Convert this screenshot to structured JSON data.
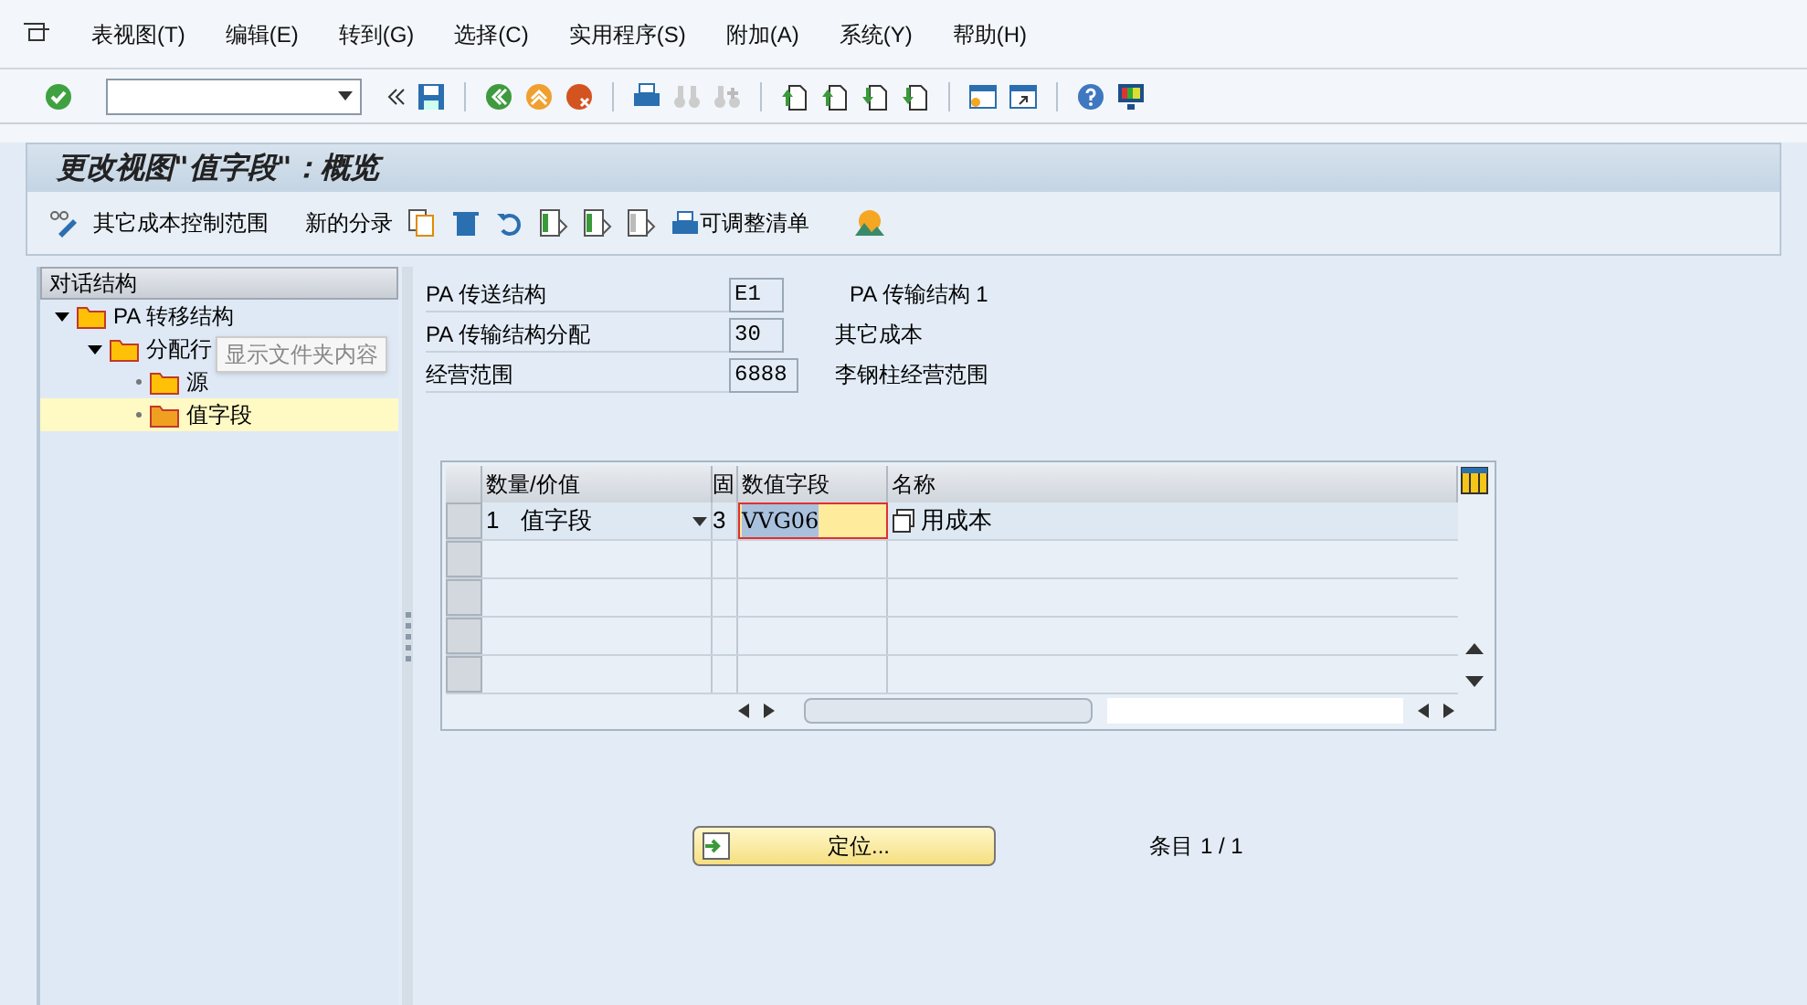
{
  "menu": [
    "表视图(T)",
    "编辑(E)",
    "转到(G)",
    "选择(C)",
    "实用程序(S)",
    "附加(A)",
    "系统(Y)",
    "帮助(H)"
  ],
  "title": "更改视图\"值字段\"：概览",
  "app_toolbar": [
    {
      "kind": "icon-text",
      "label": "其它成本控制范围"
    },
    {
      "kind": "text",
      "label": "新的分录"
    },
    {
      "kind": "print",
      "label": "可调整清单"
    }
  ],
  "tree": {
    "header": "对话结构",
    "items": [
      {
        "label": "PA 转移结构",
        "expanded": true,
        "selected": false,
        "children": [
          {
            "label": "分配行",
            "expanded": true,
            "selected": false,
            "children": [
              {
                "label": "源",
                "selected": false
              },
              {
                "label": "值字段",
                "selected": true
              }
            ]
          }
        ]
      }
    ]
  },
  "tooltip": "显示文件夹内容",
  "fields": [
    {
      "label": "PA 传送结构",
      "value": "E1",
      "description": "PA 传输结构 1"
    },
    {
      "label": "PA 传输结构分配",
      "value": "30",
      "description": "其它成本"
    },
    {
      "label": "经营范围",
      "value": "6888",
      "description": "李钢柱经营范围"
    }
  ],
  "table": {
    "columns": [
      "数量/价值",
      "固",
      "数值字段",
      "名称"
    ],
    "rows": [
      {
        "type": "1",
        "type_label": "值字段",
        "fixed": "3",
        "field": "VVG06",
        "name": "用成本",
        "focused": true
      }
    ]
  },
  "position_button": "定位...",
  "entry_label": "条目",
  "entry_count": "1 / 1"
}
